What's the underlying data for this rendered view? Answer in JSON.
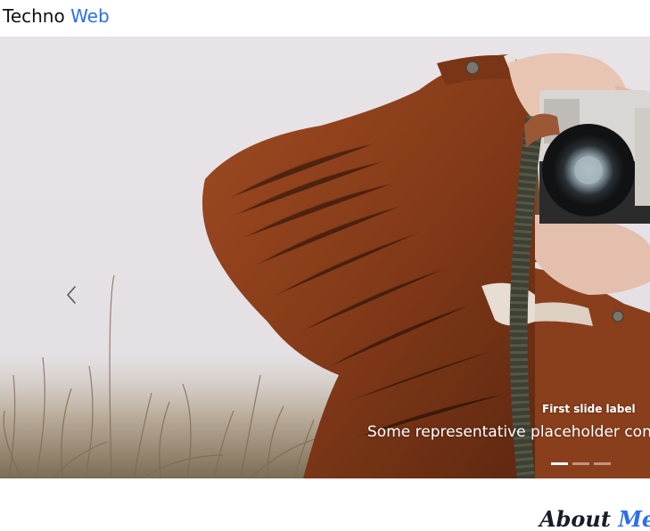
{
  "navbar": {
    "brand_main": "Techno",
    "brand_accent": "Web"
  },
  "carousel": {
    "prev_icon": "chevron-left-icon",
    "slides": [
      {
        "title": "First slide label",
        "text": "Some representative placeholder conte",
        "active": true
      },
      {
        "active": false
      },
      {
        "active": false
      }
    ]
  },
  "about": {
    "heading_main": "About",
    "heading_accent": "Me"
  },
  "colors": {
    "accent": "#2a6ef0",
    "jacket": "#8a3f1c",
    "sky": "#e6e2e6"
  }
}
